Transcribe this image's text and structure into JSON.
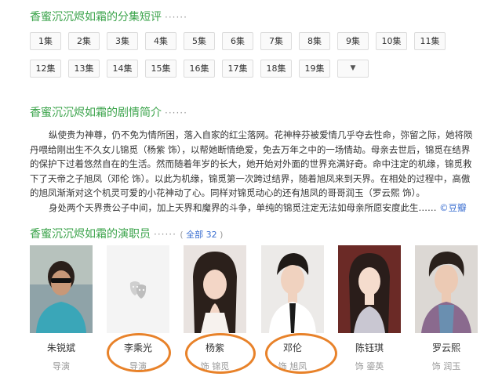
{
  "episodes_section": {
    "title": "香蜜沉沉烬如霜的分集短评",
    "dots": "······",
    "episodes": [
      "1集",
      "2集",
      "3集",
      "4集",
      "5集",
      "6集",
      "7集",
      "8集",
      "9集",
      "10集",
      "11集",
      "12集",
      "13集",
      "14集",
      "15集",
      "16集",
      "17集",
      "18集",
      "19集"
    ],
    "more_icon": "▼"
  },
  "synopsis_section": {
    "title": "香蜜沉沉烬如霜的剧情简介",
    "dots": "······",
    "paragraph1": "纵使贵为神尊，仍不免为情所困，落入自家的红尘落网。花神梓芬被爱情几乎夺去性命，弥留之际，她将陨丹喂给刚出生不久女儿锦觅（杨紫 饰），以帮她断情绝爱，免去万年之中的一场情劫。母亲去世后，锦觅在结界的保护下过着悠然自在的生活。然而随着年岁的长大，她开始对外面的世界充满好奇。命中注定的机缘，锦觅救下了天帝之子旭凤（邓伦 饰）。以此为机缘，锦觅第一次跨过结界，随着旭凤来到天界。在相处的过程中，高傲的旭凤渐渐对这个机灵可爱的小花神动了心。同样对锦觅动心的还有旭凤的哥哥润玉（罗云熙 饰）。",
    "paragraph2": "身处两个天界贵公子中间，加上天界和魔界的斗争，单纯的锦觅注定无法如母亲所愿安度此生……",
    "source_link": "©豆瓣"
  },
  "cast_section": {
    "title": "香蜜沉沉烬如霜的演职员",
    "dots": "······",
    "count_prefix": "(",
    "count_link": "全部 32",
    "count_suffix": ")",
    "members": [
      {
        "name": "朱锐斌",
        "role": "导演"
      },
      {
        "name": "李乘光",
        "role": "导演"
      },
      {
        "name": "杨紫",
        "role": "饰 锦觅"
      },
      {
        "name": "邓伦",
        "role": "饰 旭凤"
      },
      {
        "name": "陈钰琪",
        "role": "饰 鎏英"
      },
      {
        "name": "罗云熙",
        "role": "饰 润玉"
      }
    ]
  },
  "colors": {
    "title_green": "#3aa34a",
    "link_blue": "#3b6fd1",
    "circle_orange": "#e8822a"
  }
}
